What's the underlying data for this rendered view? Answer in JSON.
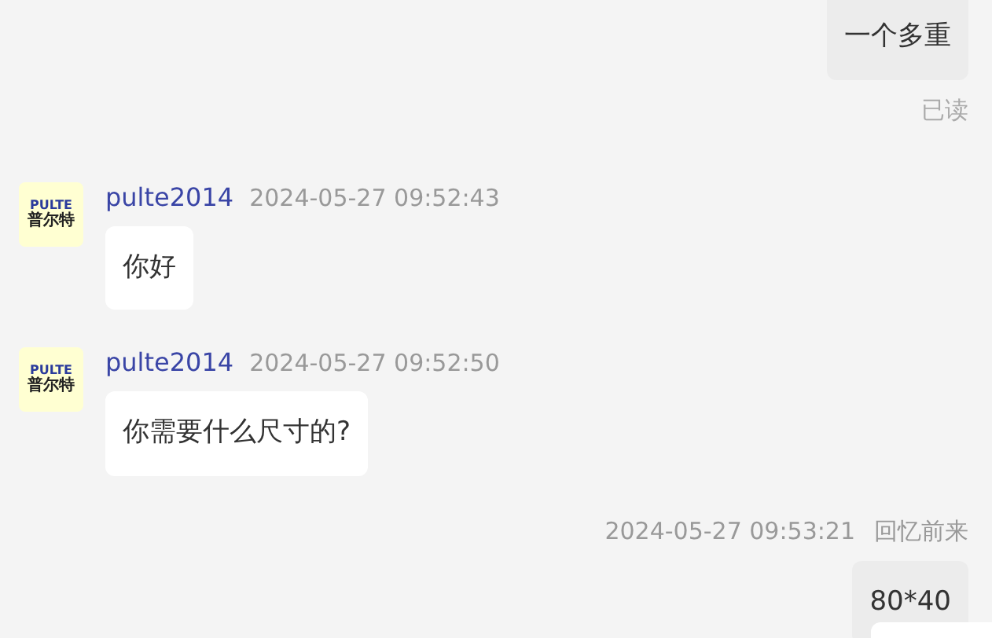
{
  "messages": [
    {
      "kind": "outgoing",
      "text": "一个多重",
      "status": "已读"
    },
    {
      "kind": "incoming",
      "sender": "pulte2014",
      "time": "2024-05-27 09:52:43",
      "avatar": {
        "brand": "PULTE",
        "name": "普尔特"
      },
      "text": "你好"
    },
    {
      "kind": "incoming",
      "sender": "pulte2014",
      "time": "2024-05-27 09:52:50",
      "avatar": {
        "brand": "PULTE",
        "name": "普尔特"
      },
      "text": "你需要什么尺寸的?"
    },
    {
      "kind": "outgoing",
      "time": "2024-05-27 09:53:21",
      "sender": "回忆前来",
      "text": "80*40"
    }
  ]
}
